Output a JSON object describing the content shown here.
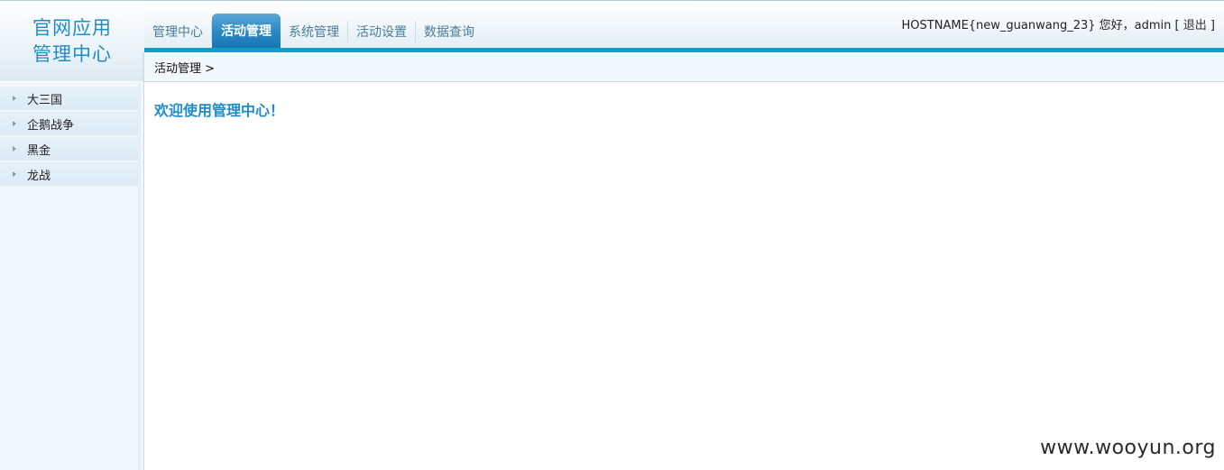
{
  "logo": {
    "line1": "官网应用",
    "line2": "管理中心"
  },
  "nav": {
    "tabs": [
      {
        "label": "管理中心",
        "active": false
      },
      {
        "label": "活动管理",
        "active": true
      },
      {
        "label": "系统管理",
        "active": false
      },
      {
        "label": "活动设置",
        "active": false
      },
      {
        "label": "数据查询",
        "active": false
      }
    ]
  },
  "user": {
    "hostname": "HOSTNAME{new_guanwang_23}",
    "greeting": "您好，admin",
    "bracket_open": "[",
    "logout": "退出",
    "bracket_close": "]"
  },
  "breadcrumb": {
    "text": "活动管理 >"
  },
  "sidebar": {
    "items": [
      {
        "label": "大三国"
      },
      {
        "label": "企鹅战争"
      },
      {
        "label": "黑金"
      },
      {
        "label": "龙战"
      }
    ]
  },
  "main": {
    "welcome": "欢迎使用管理中心！"
  },
  "watermark": "www.wooyun.org",
  "colors": {
    "accent": "#1e8cc8",
    "blue_line": "#0e9ec9",
    "active_tab": "#2d8ac4"
  }
}
